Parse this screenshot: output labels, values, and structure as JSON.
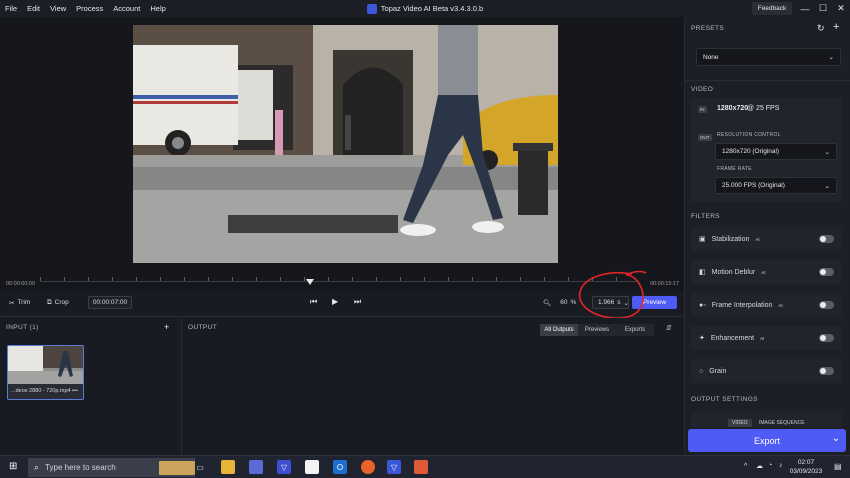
{
  "menu": {
    "items": [
      "File",
      "Edit",
      "View",
      "Process",
      "Account",
      "Help"
    ]
  },
  "app": {
    "title": "Topaz Video AI Beta  v3.4.3.0.b",
    "feedback_label": "Feedback"
  },
  "timeline": {
    "start_time": "00:00:00:00",
    "end_time": "00:00:15:17"
  },
  "controls": {
    "trim_label": "Trim",
    "crop_label": "Crop",
    "time_value": "00:00:07:00",
    "zoom_value": "60",
    "zoom_unit": "%",
    "duration_value": "1.966",
    "duration_unit": "s",
    "preview_label": "Preview"
  },
  "input": {
    "header": "INPUT (1)",
    "add_label": "+",
    "file_name": "...deos 2880 - 720p.mp4",
    "more": "•••"
  },
  "output": {
    "header": "OUTPUT",
    "tabs": [
      "All Outputs",
      "Previews",
      "Exports"
    ],
    "active_tab": 0
  },
  "sidebar": {
    "presets_title": "PRESETS",
    "preset_value": "None",
    "video_title": "VIDEO",
    "in_badge": "IN",
    "in_resolution": "1280x720",
    "in_fps_text": "@ 25 FPS",
    "out_badge": "OUT",
    "resolution_control_label": "RESOLUTION CONTROL",
    "resolution_value": "1280x720 (Original)",
    "frame_rate_label": "FRAME RATE",
    "frame_rate_value": "25.000 FPS (Original)",
    "filters_title": "FILTERS",
    "filters": [
      {
        "label": "Stabilization",
        "ai": "AI",
        "icon": "stabilization-icon",
        "enabled": false
      },
      {
        "label": "Motion Deblur",
        "ai": "AI",
        "icon": "motion-deblur-icon",
        "enabled": false
      },
      {
        "label": "Frame Interpolation",
        "ai": "AI",
        "icon": "frame-interpolation-icon",
        "enabled": false
      },
      {
        "label": "Enhancement",
        "ai": "AI",
        "icon": "enhancement-icon",
        "enabled": false
      },
      {
        "label": "Grain",
        "ai": "",
        "icon": "grain-icon",
        "enabled": false
      }
    ],
    "output_settings_title": "OUTPUT SETTINGS",
    "output_tabs": [
      "VIDEO",
      "IMAGE SEQUENCE"
    ],
    "export_label": "Export"
  },
  "taskbar": {
    "search_placeholder": "Type here to search",
    "time": "02:07",
    "date": "03/09/2023"
  },
  "colors": {
    "accent": "#4f5bf5",
    "annotation": "#e0262b"
  }
}
